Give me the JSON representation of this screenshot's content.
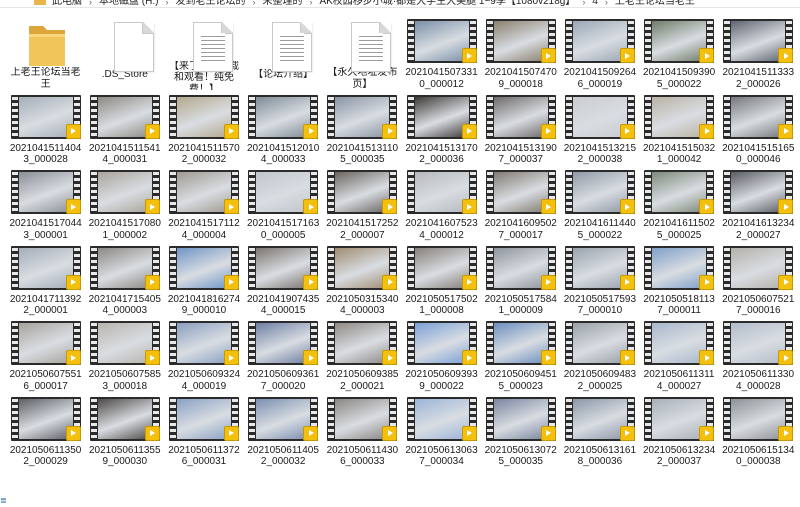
{
  "breadcrumb": {
    "segments": [
      "此电脑",
      "本地磁盘 (H:)",
      "发到老王论坛的",
      "未整理的",
      "AK校园移步小城·都是大学生大美腿 1~9季【1080v218g】",
      "4",
      "上老王论坛当老王"
    ]
  },
  "items": [
    {
      "kind": "folder",
      "name": "上老王论坛当老王"
    },
    {
      "kind": "doc-blank",
      "name": ".DS_Store"
    },
    {
      "kind": "doc",
      "name": "【来了就能下载和观看！纯免费！】"
    },
    {
      "kind": "doc",
      "name": "【论坛介绍】"
    },
    {
      "kind": "doc",
      "name": "【永久地址发布页】"
    },
    {
      "kind": "video",
      "name": "20210415073310_000012",
      "color": "#7a8fa8"
    },
    {
      "kind": "video",
      "name": "20210415074709_000018",
      "color": "#8a7f6e"
    },
    {
      "kind": "video",
      "name": "20210415092646_000019",
      "color": "#9aa7b5"
    },
    {
      "kind": "video",
      "name": "20210415093905_000022",
      "color": "#6f7c6a"
    },
    {
      "kind": "video",
      "name": "20210415113332_000026",
      "color": "#5f6470"
    },
    {
      "kind": "video",
      "name": "20210415114043_000028",
      "color": "#a6aeb8"
    },
    {
      "kind": "video",
      "name": "20210415115414_000031",
      "color": "#8e8a84"
    },
    {
      "kind": "video",
      "name": "20210415115702_000032",
      "color": "#b3a88e"
    },
    {
      "kind": "video",
      "name": "20210415120104_000033",
      "color": "#7f8c96"
    },
    {
      "kind": "video",
      "name": "20210415131105_000035",
      "color": "#8a94a4"
    },
    {
      "kind": "video",
      "name": "20210415131702_000036",
      "color": "#3f3a38"
    },
    {
      "kind": "video",
      "name": "20210415131907_000037",
      "color": "#6e6a6a"
    },
    {
      "kind": "video",
      "name": "20210415132152_000038",
      "color": "#c9cdd2"
    },
    {
      "kind": "video",
      "name": "20210415150321_000042",
      "color": "#b9b2a5"
    },
    {
      "kind": "video",
      "name": "20210415151650_000046",
      "color": "#75777c"
    },
    {
      "kind": "video",
      "name": "20210415170443_000001",
      "color": "#8b8f96"
    },
    {
      "kind": "video",
      "name": "20210415170801_000002",
      "color": "#a9a49c"
    },
    {
      "kind": "video",
      "name": "20210415171124_000004",
      "color": "#9f9a92"
    },
    {
      "kind": "video",
      "name": "20210415171630_000005",
      "color": "#c2c6cc"
    },
    {
      "kind": "video",
      "name": "20210415172522_000007",
      "color": "#6a6660"
    },
    {
      "kind": "video",
      "name": "20210416075234_000012",
      "color": "#b6b8bc"
    },
    {
      "kind": "video",
      "name": "20210416095027_000017",
      "color": "#827b72"
    },
    {
      "kind": "video",
      "name": "20210416114405_000022",
      "color": "#9099a6"
    },
    {
      "kind": "video",
      "name": "20210416115025_000025",
      "color": "#7d8a7a"
    },
    {
      "kind": "video",
      "name": "20210416132342_000027",
      "color": "#5a5c63"
    },
    {
      "kind": "video",
      "name": "20210417113922_000001",
      "color": "#a4adb9"
    },
    {
      "kind": "video",
      "name": "20210417154054_000003",
      "color": "#8c8883"
    },
    {
      "kind": "video",
      "name": "20210418162749_000010",
      "color": "#6f95c5"
    },
    {
      "kind": "video",
      "name": "20210419074354_000015",
      "color": "#7c7670"
    },
    {
      "kind": "video",
      "name": "20210503153404_000003",
      "color": "#a08c72"
    },
    {
      "kind": "video",
      "name": "20210505175021_000008",
      "color": "#86807a"
    },
    {
      "kind": "video",
      "name": "20210505175841_000009",
      "color": "#8f959d"
    },
    {
      "kind": "video",
      "name": "20210505175937_000010",
      "color": "#9aa3ae"
    },
    {
      "kind": "video",
      "name": "20210505181137_000011",
      "color": "#7f9fc8"
    },
    {
      "kind": "video",
      "name": "20210506075217_000016",
      "color": "#b4b0aa"
    },
    {
      "kind": "video",
      "name": "20210506075516_000017",
      "color": "#a7a39d"
    },
    {
      "kind": "video",
      "name": "20210506075853_000018",
      "color": "#b8b4ae"
    },
    {
      "kind": "video",
      "name": "20210506093244_000019",
      "color": "#8a9fbf"
    },
    {
      "kind": "video",
      "name": "20210506093617_000020",
      "color": "#6d7fa3"
    },
    {
      "kind": "video",
      "name": "20210506093852_000021",
      "color": "#8f8a86"
    },
    {
      "kind": "video",
      "name": "20210506093939_000022",
      "color": "#7aa0d6"
    },
    {
      "kind": "video",
      "name": "20210506094515_000023",
      "color": "#6c8fc0"
    },
    {
      "kind": "video",
      "name": "20210506094832_000025",
      "color": "#9aa0a8"
    },
    {
      "kind": "video",
      "name": "20210506113114_000027",
      "color": "#a8b7cc"
    },
    {
      "kind": "video",
      "name": "20210506113304_000028",
      "color": "#b2bccb"
    },
    {
      "kind": "video",
      "name": "20210506113502_000029",
      "color": "#5d6066"
    },
    {
      "kind": "video",
      "name": "20210506113559_000030",
      "color": "#4f4b49"
    },
    {
      "kind": "video",
      "name": "20210506113726_000031",
      "color": "#8aa1c4"
    },
    {
      "kind": "video",
      "name": "20210506114052_000032",
      "color": "#7b8fb0"
    },
    {
      "kind": "video",
      "name": "20210506114306_000033",
      "color": "#8b8683"
    },
    {
      "kind": "video",
      "name": "20210506130637_000034",
      "color": "#9ab4d8"
    },
    {
      "kind": "video",
      "name": "20210506130725_000035",
      "color": "#7a86a0"
    },
    {
      "kind": "video",
      "name": "20210506131618_000036",
      "color": "#8c97a8"
    },
    {
      "kind": "video",
      "name": "20210506132342_000037",
      "color": "#a9b0b8"
    },
    {
      "kind": "video",
      "name": "20210506151340_000038",
      "color": "#8e9196"
    }
  ],
  "status": {
    "glyph": "≣"
  }
}
